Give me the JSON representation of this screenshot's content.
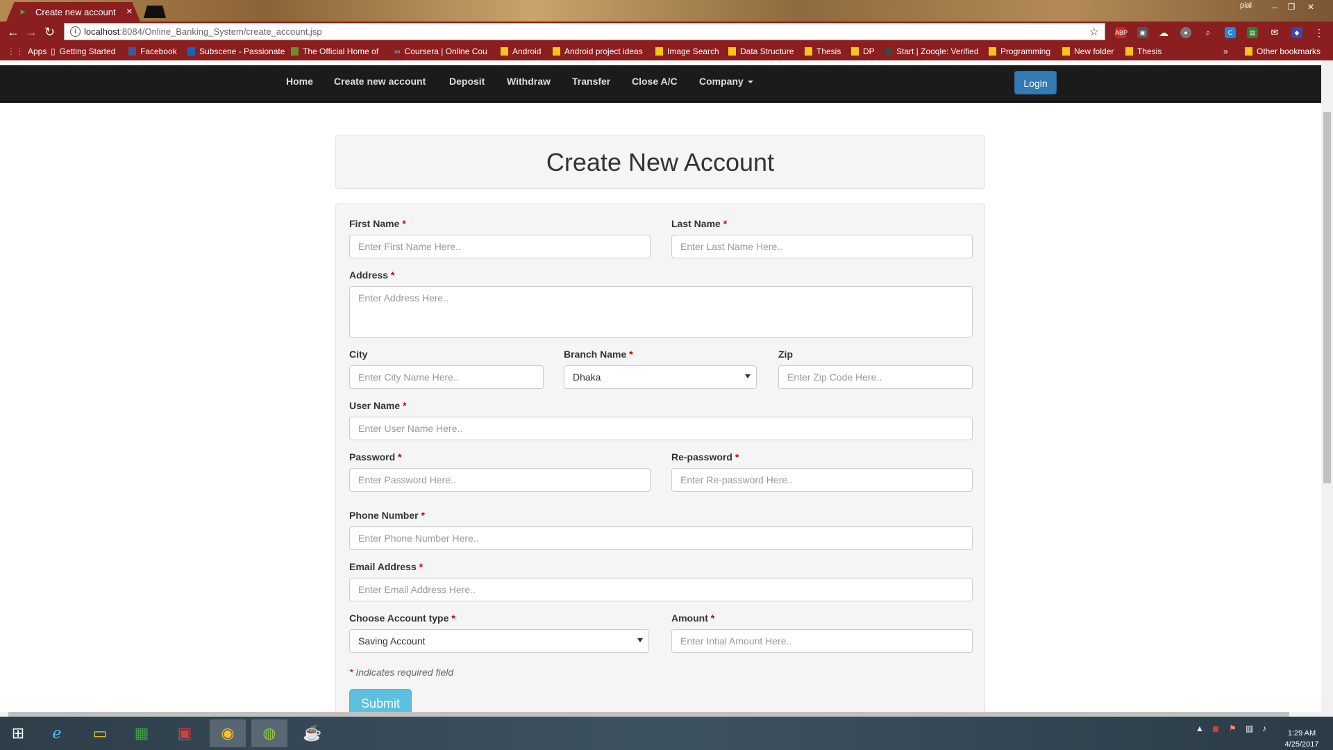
{
  "browser": {
    "tab_title": "Create new account",
    "tab_close": "×",
    "user_label": "pial",
    "url_host": "localhost",
    "url_path": ":8084/Online_Banking_System/create_account.jsp",
    "bookmarks": [
      {
        "label": "Apps"
      },
      {
        "label": "Getting Started"
      },
      {
        "label": "Facebook"
      },
      {
        "label": "Subscene - Passionate"
      },
      {
        "label": "The Official Home of"
      },
      {
        "label": "Coursera | Online Cou"
      },
      {
        "label": "Android"
      },
      {
        "label": "Android project ideas"
      },
      {
        "label": "Image Search"
      },
      {
        "label": "Data Structure"
      },
      {
        "label": "Thesis"
      },
      {
        "label": "DP"
      },
      {
        "label": "Start | Zooqle: Verified"
      },
      {
        "label": "Programming"
      },
      {
        "label": "New folder"
      },
      {
        "label": "Thesis"
      },
      {
        "label": "»"
      },
      {
        "label": "Other bookmarks"
      }
    ]
  },
  "nav": {
    "items": [
      "Home",
      "Create new account",
      "Deposit",
      "Withdraw",
      "Transfer",
      "Close A/C",
      "Company"
    ],
    "login": "Login"
  },
  "form": {
    "title": "Create New Account",
    "first_name": {
      "label": "First Name",
      "placeholder": "Enter First Name Here.."
    },
    "last_name": {
      "label": "Last Name",
      "placeholder": "Enter Last Name Here.."
    },
    "address": {
      "label": "Address",
      "placeholder": "Enter Address Here.."
    },
    "city": {
      "label": "City",
      "placeholder": "Enter City Name Here.."
    },
    "branch": {
      "label": "Branch Name",
      "value": "Dhaka"
    },
    "zip": {
      "label": "Zip",
      "placeholder": "Enter Zip Code Here.."
    },
    "user_name": {
      "label": "User Name",
      "placeholder": "Enter User Name Here.."
    },
    "password": {
      "label": "Password",
      "placeholder": "Enter Password Here.."
    },
    "repassword": {
      "label": "Re-password",
      "placeholder": "Enter Re-password Here.."
    },
    "phone": {
      "label": "Phone Number",
      "placeholder": "Enter Phone Number Here.."
    },
    "email": {
      "label": "Email Address",
      "placeholder": "Enter Email Address Here.."
    },
    "account_type": {
      "label": "Choose Account type",
      "value": "Saving Account"
    },
    "amount": {
      "label": "Amount",
      "placeholder": "Enter Intial Amount Here.."
    },
    "required_mark": "*",
    "required_note": "Indicates required field",
    "submit": "Submit"
  },
  "taskbar": {
    "time": "1:29 AM",
    "date": "4/25/2017"
  },
  "colors": {
    "chrome_frame": "#8b1e1e",
    "navbar": "#1b1b1b",
    "login_button": "#337ab7",
    "submit_button": "#5bc0de",
    "required": "#cc0000"
  }
}
